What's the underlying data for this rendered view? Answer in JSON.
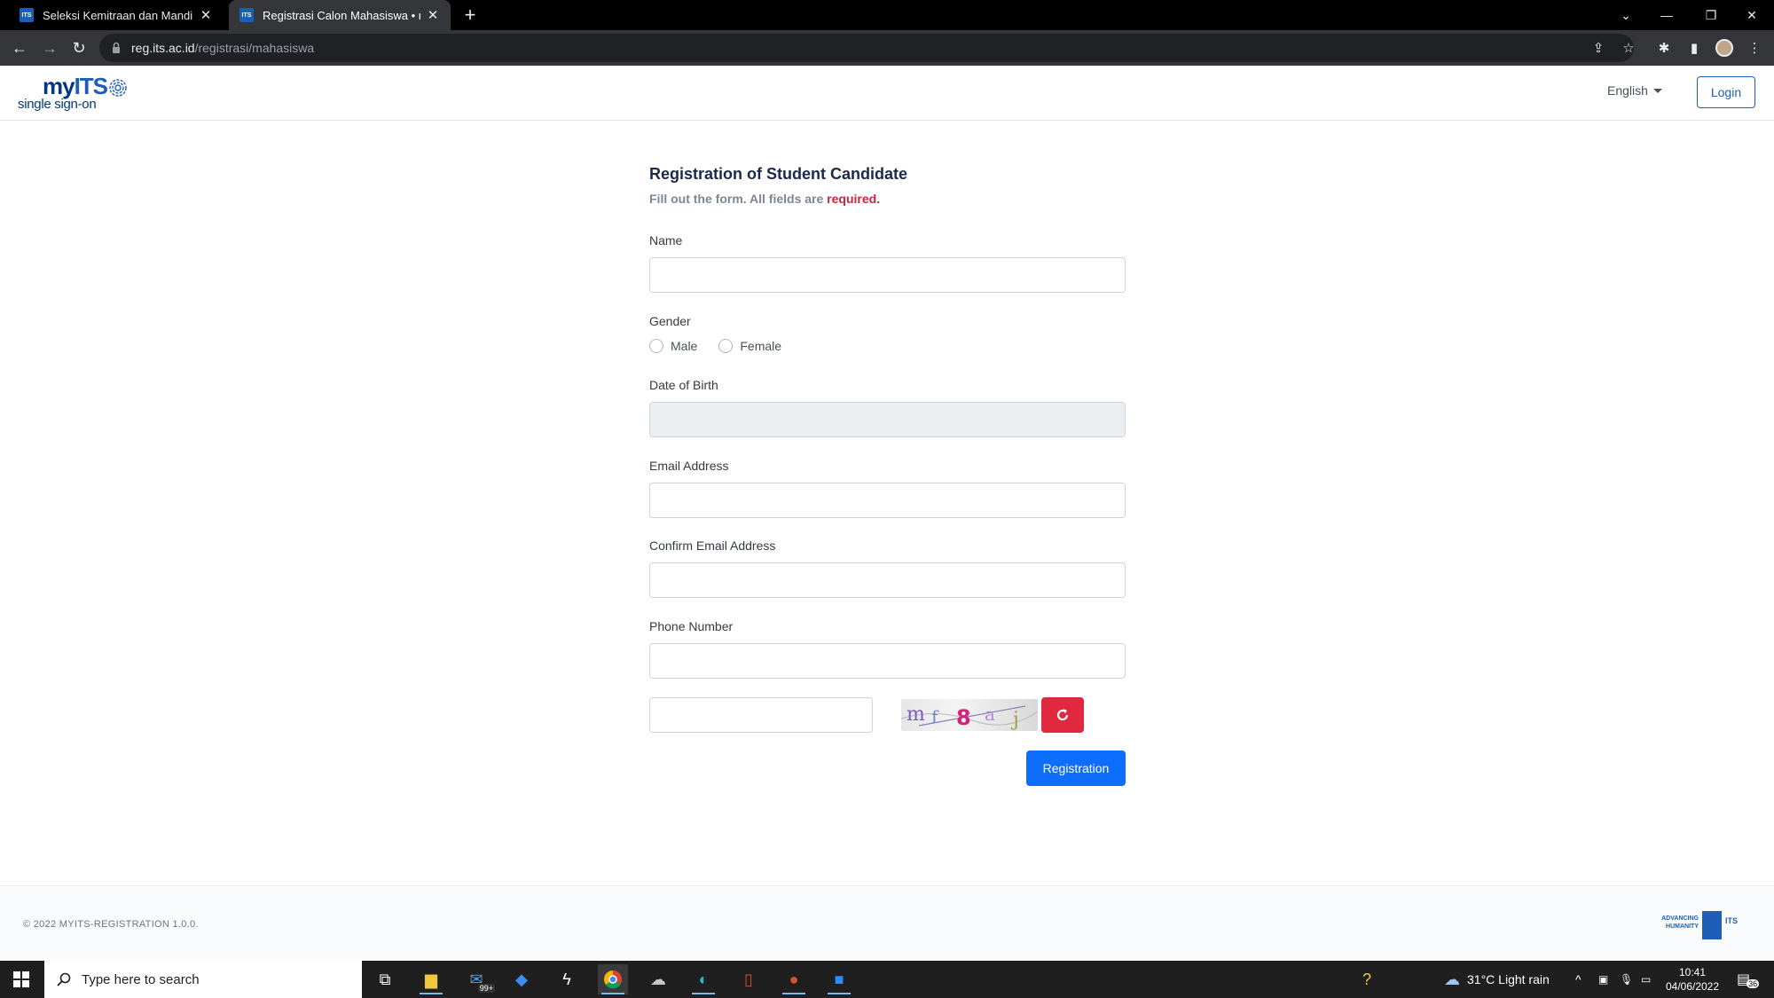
{
  "browser": {
    "tabs": [
      {
        "title": "Seleksi Kemitraan dan Mandiri P",
        "favicon": "ITS"
      },
      {
        "title": "Registrasi Calon Mahasiswa • my",
        "favicon": "ITS"
      }
    ],
    "url_host": "reg.its.ac.id",
    "url_path": "/registrasi/mahasiswa"
  },
  "header": {
    "logo_main": "my",
    "logo_its": "ITS",
    "logo_sub": "single sign-on",
    "language": "English",
    "login_label": "Login"
  },
  "form": {
    "title": "Registration of Student Candidate",
    "subtitle": "Fill out the form. All fields are ",
    "subtitle_required": "required.",
    "name_label": "Name",
    "gender_label": "Gender",
    "gender_male": "Male",
    "gender_female": "Female",
    "dob_label": "Date of Birth",
    "email_label": "Email Address",
    "confirm_email_label": "Confirm Email Address",
    "phone_label": "Phone Number",
    "captcha_text": "mf8aj",
    "submit_label": "Registration"
  },
  "footer": {
    "copyright": "© 2022 MYITS-REGISTRATION 1.0.0.",
    "badge_line1": "ADVANCING",
    "badge_line2": "HUMANITY",
    "badge_its": "ITS"
  },
  "taskbar": {
    "search_placeholder": "Type here to search",
    "mail_badge": "99+",
    "weather": "31°C  Light rain",
    "time": "10:41",
    "date": "04/06/2022",
    "notifications": "36"
  },
  "colors": {
    "primary": "#0d6efd",
    "brand_blue": "#1d5eb8",
    "danger": "#e0283e",
    "required": "#d0243a"
  }
}
